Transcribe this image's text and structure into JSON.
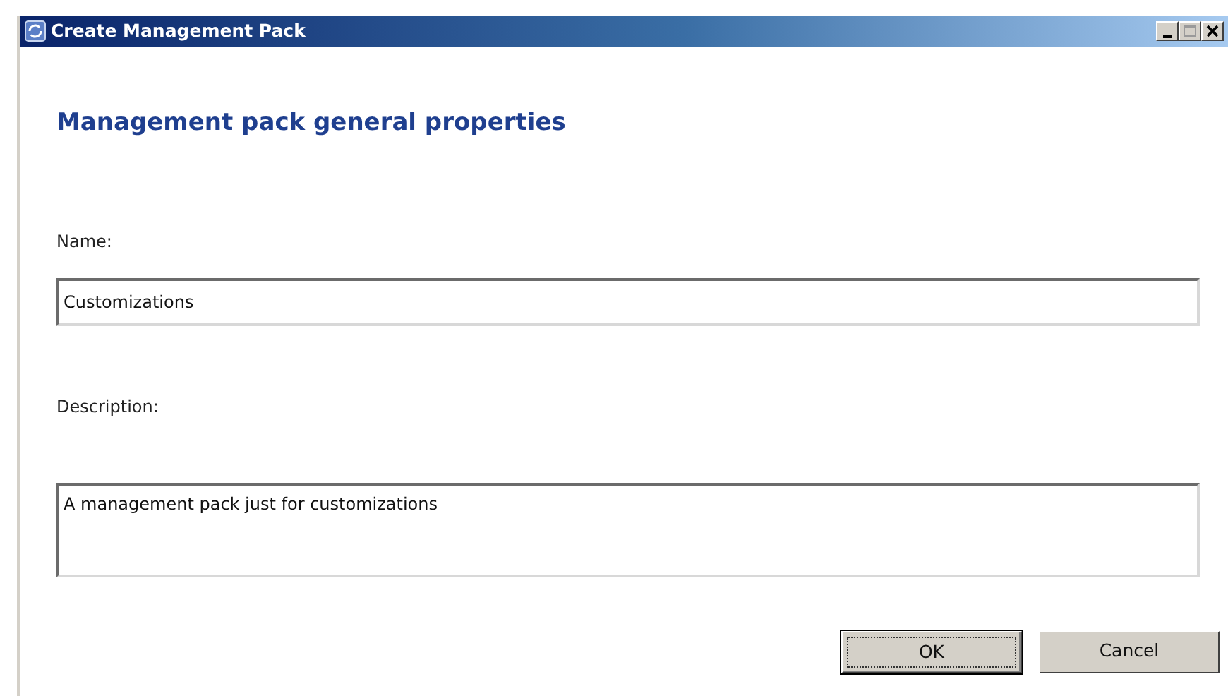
{
  "window": {
    "title": "Create Management Pack",
    "controls": [
      {
        "kind": "minimize"
      },
      {
        "kind": "maximize",
        "disabled": true
      },
      {
        "kind": "close"
      }
    ]
  },
  "heading": "Management pack general properties",
  "fields": [
    {
      "label": "Name:",
      "value": "Customizations",
      "kind": "single"
    },
    {
      "label": "Description:",
      "value": "A management pack just for customizations",
      "kind": "multi"
    }
  ],
  "buttons": [
    {
      "label": "OK",
      "focused": true
    },
    {
      "label": "Cancel",
      "focused": false
    }
  ]
}
